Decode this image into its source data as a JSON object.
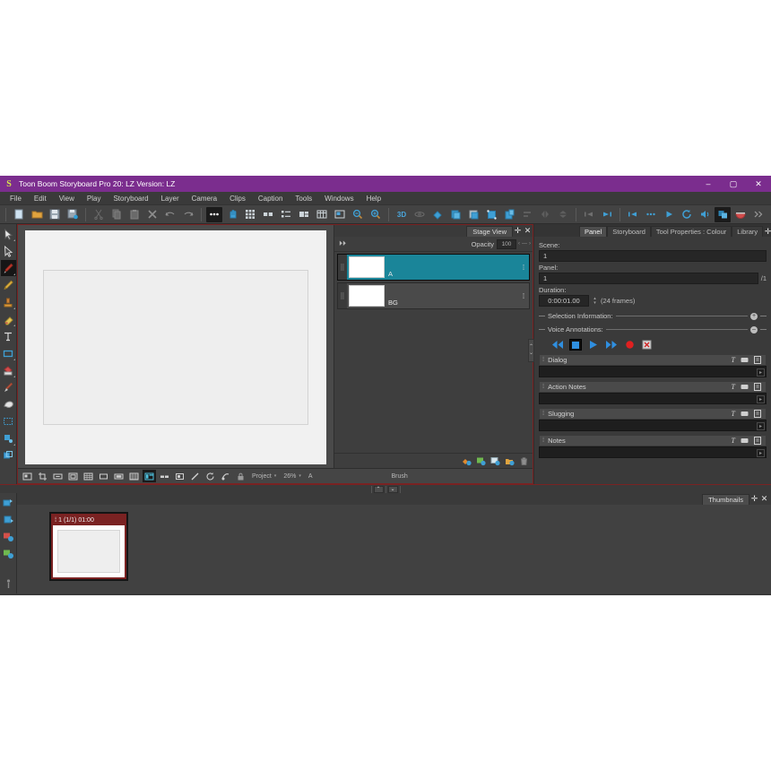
{
  "window": {
    "title": "Toon Boom Storyboard Pro 20: LZ Version: LZ",
    "logo": "S",
    "minimize": "–",
    "maximize": "▢",
    "close": "✕",
    "accent": "#7b2d8e"
  },
  "menubar": {
    "items": [
      {
        "label": "File"
      },
      {
        "label": "Edit"
      },
      {
        "label": "View"
      },
      {
        "label": "Play"
      },
      {
        "label": "Storyboard"
      },
      {
        "label": "Layer"
      },
      {
        "label": "Camera"
      },
      {
        "label": "Clips"
      },
      {
        "label": "Caption"
      },
      {
        "label": "Tools"
      },
      {
        "label": "Windows"
      },
      {
        "label": "Help"
      }
    ]
  },
  "toolbar": {
    "file_group": [
      {
        "name": "new-project-icon"
      },
      {
        "name": "open-project-icon"
      },
      {
        "name": "save-icon"
      },
      {
        "name": "save-all-icon"
      }
    ],
    "edit_group": [
      {
        "name": "cut-icon"
      },
      {
        "name": "copy-icon"
      },
      {
        "name": "paste-icon"
      },
      {
        "name": "delete-icon"
      },
      {
        "name": "undo-icon"
      },
      {
        "name": "redo-icon"
      }
    ],
    "view_group": [
      {
        "name": "more-options-icon",
        "active": true
      },
      {
        "name": "hand-icon"
      },
      {
        "name": "grid-icon"
      },
      {
        "name": "two-pane-icon"
      },
      {
        "name": "list-view-icon"
      },
      {
        "name": "split-view-icon"
      },
      {
        "name": "table-view-icon"
      },
      {
        "name": "image-view-icon"
      },
      {
        "name": "zoom-out-icon"
      },
      {
        "name": "zoom-in-icon"
      }
    ],
    "three_d_group": [
      {
        "name": "3d-toggle-icon",
        "label": "3D"
      },
      {
        "name": "3d-rotate-icon"
      },
      {
        "name": "add-layer-icon"
      },
      {
        "name": "duplicate-layer-icon"
      },
      {
        "name": "copy-layer-icon"
      },
      {
        "name": "transform-layer-icon"
      },
      {
        "name": "paste-layer-icon"
      },
      {
        "name": "align-icon"
      },
      {
        "name": "flip-h-icon"
      },
      {
        "name": "flip-v-icon"
      }
    ],
    "nav_group": [
      {
        "name": "previous-panel-icon"
      },
      {
        "name": "next-panel-icon"
      }
    ],
    "playback_group": [
      {
        "name": "rewind-icon"
      },
      {
        "name": "stop-play-icon"
      },
      {
        "name": "play-icon"
      },
      {
        "name": "loop-icon"
      },
      {
        "name": "sound-icon"
      },
      {
        "name": "onion-skin-icon",
        "active": true
      },
      {
        "name": "colour-pot-icon"
      },
      {
        "name": "overflow-icon"
      }
    ]
  },
  "left_tools": [
    {
      "name": "pointer-tool",
      "active": false
    },
    {
      "name": "selection-tool",
      "active": false
    },
    {
      "name": "brush-tool",
      "active": true
    },
    {
      "name": "pencil-tool",
      "active": false
    },
    {
      "name": "stamp-tool",
      "active": false
    },
    {
      "name": "eraser-tool",
      "active": false
    },
    {
      "name": "text-tool",
      "active": false
    },
    {
      "name": "rectangle-tool",
      "active": false
    },
    {
      "name": "paint-bucket-tool",
      "active": false
    },
    {
      "name": "dropper-tool",
      "active": false
    },
    {
      "name": "smudge-tool",
      "active": false
    },
    {
      "name": "marquee-tool",
      "active": false
    },
    {
      "name": "cutter-tool",
      "active": false
    },
    {
      "name": "perspective-tool",
      "active": false
    }
  ],
  "left_tools_lower": [
    {
      "name": "import-images-tool"
    },
    {
      "name": "export-tool"
    },
    {
      "name": "render-tool"
    },
    {
      "name": "composite-tool"
    }
  ],
  "layers_panel": {
    "tab": "Stage View",
    "add_label": "✛",
    "close_label": "✕",
    "expand_icon": "⏵⏵",
    "opacity_label": "Opacity",
    "opacity_value": "100",
    "opacity_prev": "‹",
    "opacity_slider": "—",
    "opacity_next": "›",
    "rows": [
      {
        "name": "A",
        "selected": true
      },
      {
        "name": "BG",
        "selected": false
      }
    ],
    "footer_actions": [
      {
        "name": "add-vector-layer-icon"
      },
      {
        "name": "add-bitmap-layer-icon"
      },
      {
        "name": "add-3d-layer-icon"
      },
      {
        "name": "duplicate-layer-icon"
      },
      {
        "name": "delete-layer-icon"
      }
    ]
  },
  "stage_bar": {
    "tools": [
      {
        "name": "camera-view-icon"
      },
      {
        "name": "crop-icon"
      },
      {
        "name": "fit-width-icon"
      },
      {
        "name": "fit-page-icon"
      },
      {
        "name": "grid-overlay-icon"
      },
      {
        "name": "safe-area-icon"
      },
      {
        "name": "title-safe-icon"
      },
      {
        "name": "field-grid-icon"
      },
      {
        "name": "light-table-icon",
        "active": true
      },
      {
        "name": "onion-skin-icon"
      },
      {
        "name": "reference-icon"
      },
      {
        "name": "line-icon"
      },
      {
        "name": "rotate-view-icon"
      },
      {
        "name": "reset-view-icon"
      },
      {
        "name": "lock-icon"
      }
    ],
    "project_label": "Project",
    "zoom_label": "26%",
    "layer_label": "A",
    "tool_label": "Brush"
  },
  "right_dock": {
    "tabs": [
      {
        "label": "Panel",
        "active": true
      },
      {
        "label": "Storyboard",
        "active": false
      },
      {
        "label": "Tool Properties : Colour",
        "active": false
      },
      {
        "label": "Library",
        "active": false
      }
    ],
    "add_label": "✛",
    "close_label": "✕",
    "scene_label": "Scene:",
    "scene_value": "1",
    "panel_label": "Panel:",
    "panel_value": "1",
    "panel_total": "/1",
    "duration_label": "Duration:",
    "duration_value": "0:00:01.00",
    "duration_frames": "(24 frames)",
    "sections": [
      {
        "label": "Selection Information:",
        "knob": "+"
      },
      {
        "label": "Voice Annotations:",
        "knob": "–"
      }
    ],
    "transport": [
      {
        "name": "rewind-button",
        "boxed": false
      },
      {
        "name": "stop-button",
        "boxed": true
      },
      {
        "name": "play-button",
        "boxed": false
      },
      {
        "name": "fast-forward-button",
        "boxed": false
      },
      {
        "name": "record-button",
        "boxed": false
      },
      {
        "name": "delete-recording-button",
        "boxed": false
      }
    ],
    "notes": [
      {
        "title": "Dialog",
        "value": ""
      },
      {
        "title": "Action Notes",
        "value": ""
      },
      {
        "title": "Slugging",
        "value": ""
      },
      {
        "title": "Notes",
        "value": ""
      }
    ],
    "note_tool_icons": [
      {
        "name": "text-format-icon",
        "glyph": "T"
      },
      {
        "name": "caption-icon"
      },
      {
        "name": "expand-note-icon"
      }
    ],
    "side_handle_up": "⌃",
    "side_handle_down": "⌄"
  },
  "divider": {
    "collapse_up": "⌃",
    "collapse_down": "⌄"
  },
  "thumbnails_panel": {
    "tab": "Thumbnails",
    "add_label": "✛",
    "close_label": "✕",
    "panels": [
      {
        "caption": "1 (1/1) 01:00"
      }
    ]
  }
}
